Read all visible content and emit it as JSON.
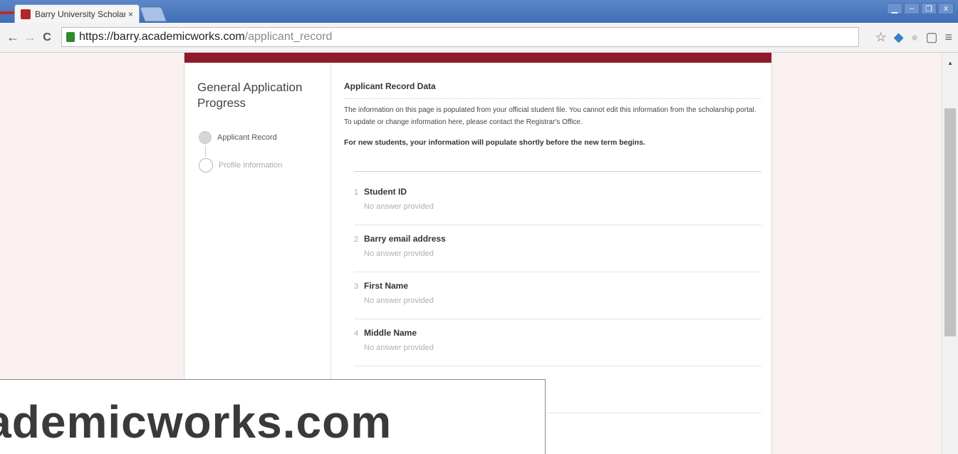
{
  "browser": {
    "tab_title": "Barry University Scholarsh",
    "tab_close": "×",
    "url_host": "https://barry.academicworks.com",
    "url_path": "/applicant_record",
    "window_controls": [
      "▁",
      "–",
      "❐",
      "x"
    ]
  },
  "sidebar": {
    "title": "General Application Progress",
    "steps": [
      {
        "label": "Applicant Record",
        "state": "complete"
      },
      {
        "label": "Profile Information",
        "state": "pending"
      }
    ]
  },
  "main": {
    "title": "Applicant Record Data",
    "info_line1": "The information on this page is populated from your official student file. You cannot edit this information from the scholarship portal.",
    "info_line2": "To update or change information here, please contact the Registrar's Office.",
    "info_bold": "For new students, your information will populate shortly before the new term begins.",
    "questions": [
      {
        "num": "1",
        "label": "Student ID",
        "answer": "No answer provided"
      },
      {
        "num": "2",
        "label": "Barry email address",
        "answer": "No answer provided"
      },
      {
        "num": "3",
        "label": "First Name",
        "answer": "No answer provided"
      },
      {
        "num": "4",
        "label": "Middle Name",
        "answer": "No answer provided"
      }
    ]
  },
  "overlay": {
    "caption": "academicworks.com"
  },
  "colors": {
    "brand": "#8e1b2a",
    "page_bg": "#fbf0f0",
    "chrome": "#3f6db5"
  }
}
